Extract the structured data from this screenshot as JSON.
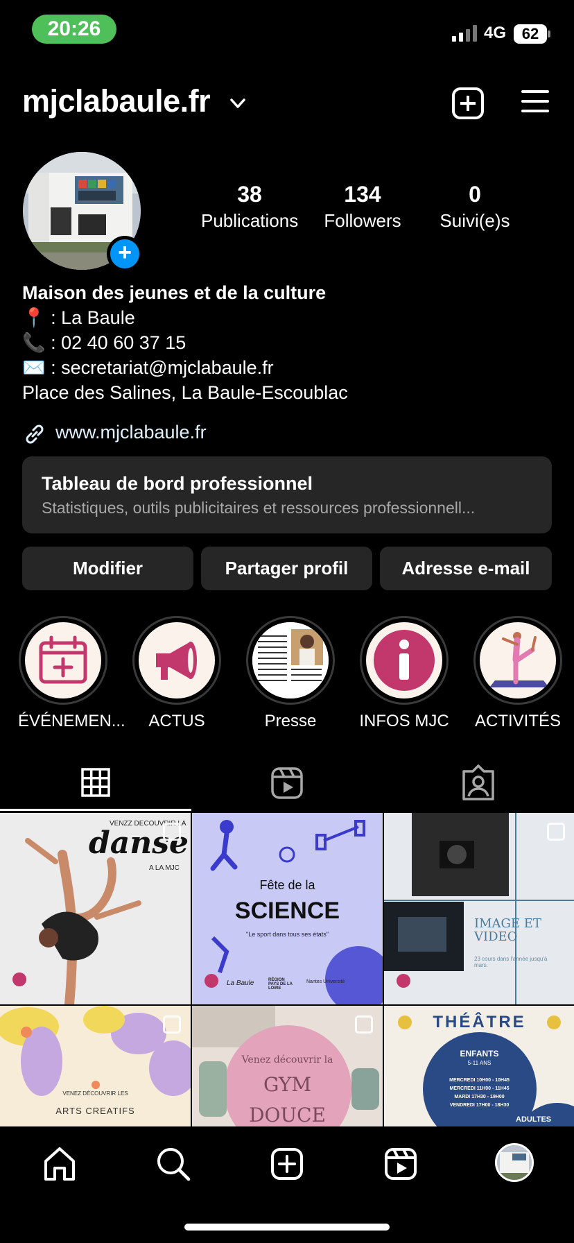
{
  "status_bar": {
    "time": "20:26",
    "network": "4G",
    "battery": "62"
  },
  "header": {
    "username": "mjclabaule.fr",
    "icons": [
      "chevron-down-icon",
      "add-post-icon",
      "menu-icon"
    ]
  },
  "profile": {
    "stats": [
      {
        "value": "38",
        "label": "Publications"
      },
      {
        "value": "134",
        "label": "Followers"
      },
      {
        "value": "0",
        "label": "Suivi(e)s"
      }
    ],
    "bio": {
      "name": "Maison des jeunes et de la culture",
      "location": "📍 : La Baule",
      "phone": "📞 : 02 40 60 37 15",
      "email": "✉️ : secretariat@mjclabaule.fr",
      "address": "Place des Salines, La Baule-Escoublac"
    },
    "link": "www.mjclabaule.fr"
  },
  "dashboard": {
    "title": "Tableau de bord professionnel",
    "subtitle": "Statistiques, outils publicitaires et ressources professionnell..."
  },
  "buttons": {
    "edit": "Modifier",
    "share": "Partager profil",
    "email": "Adresse e-mail"
  },
  "highlights": [
    {
      "label": "ÉVÉNEMEN...",
      "icon": "calendar-icon"
    },
    {
      "label": "ACTUS",
      "icon": "megaphone-icon"
    },
    {
      "label": "Presse",
      "icon": "press-photo"
    },
    {
      "label": "INFOS MJC",
      "icon": "info-icon"
    },
    {
      "label": "ACTIVITÉS",
      "icon": "yoga-icon"
    }
  ],
  "tabs": [
    "grid-icon",
    "reels-icon",
    "tagged-icon"
  ],
  "posts": [
    {
      "top": "VENZZ DECOUVRIR LA",
      "title": "danse",
      "sub": "A LA MJC"
    },
    {
      "top": "Fête de la",
      "title": "SCIENCE",
      "sub": "\"Le sport dans tous ses états\"",
      "logos": [
        "La Baule",
        "RÉGION PAYS DE LA LOIRE",
        "Nantes Université"
      ]
    },
    {
      "title": "IMAGE ET VIDEO",
      "sub": "23 cours dans l'année jusqu'à mars."
    },
    {
      "top": "VENEZ DÉCOUVRIR LES",
      "title": "ARTS CREATIFS"
    },
    {
      "top": "Venez découvrir la",
      "title": "GYM DOUCE"
    },
    {
      "title": "THÉÂTRE",
      "sub": "ENFANTS",
      "sub2": "5-11 ANS",
      "schedule": [
        "MERCREDI 10H00 - 10H45",
        "MERCREDI 11H00 - 11H45",
        "MARDI 17H30 - 19H00",
        "VENDREDI 17H00 - 18H30"
      ],
      "footer": "ADULTES"
    }
  ],
  "bottom_nav": [
    "home-icon",
    "search-icon",
    "create-icon",
    "reels-icon",
    "profile-avatar"
  ],
  "colors": {
    "background": "#000000",
    "card": "#262626",
    "accent_blue": "#0095f6",
    "status_green": "#4fbf5a",
    "highlight_pink": "#c2386c"
  }
}
